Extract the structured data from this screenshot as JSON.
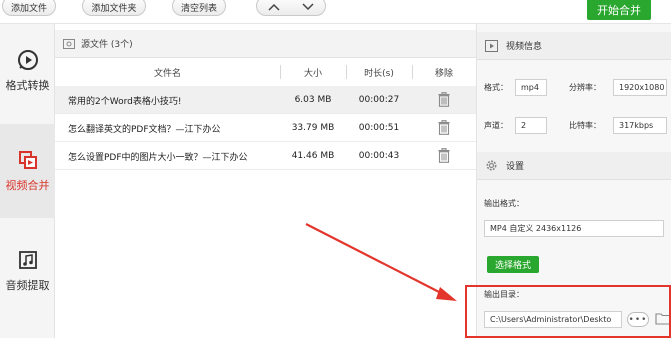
{
  "toolbar": {
    "add_file": "添加文件",
    "add_folder": "添加文件夹",
    "clear_list": "清空列表",
    "move_up": "∧",
    "move_down": "∨",
    "start_merge": "开始合并"
  },
  "sidebar": {
    "items": [
      {
        "label": "格式转换",
        "icon": "convert-play-icon"
      },
      {
        "label": "视频合并",
        "icon": "video-merge-icon",
        "active": true
      },
      {
        "label": "音频提取",
        "icon": "music-note-icon"
      }
    ]
  },
  "source": {
    "title": "源文件 (3个)",
    "columns": {
      "name": "文件名",
      "size": "大小",
      "duration": "时长(s)",
      "remove": "移除"
    },
    "rows": [
      {
        "name": "常用的2个Word表格小技巧!",
        "size": "6.03 MB",
        "duration": "00:00:27"
      },
      {
        "name": "怎么翻译英文的PDF文档？—江下办公",
        "size": "33.79 MB",
        "duration": "00:00:51"
      },
      {
        "name": "怎么设置PDF中的图片大小一致？—江下办公",
        "size": "41.46 MB",
        "duration": "00:00:43"
      }
    ]
  },
  "video_info": {
    "title": "视频信息",
    "format_label": "格式：",
    "format_value": "mp4",
    "resolution_label": "分辨率：",
    "resolution_value": "1920x1080",
    "channel_label": "声道：",
    "channel_value": "2",
    "bitrate_label": "比特率：",
    "bitrate_value": "317kbps"
  },
  "settings": {
    "title": "设置",
    "output_format_label": "输出格式：",
    "output_format_value": "MP4 自定义 2436x1126",
    "choose_format": "选择格式",
    "output_dir_label": "输出目录：",
    "output_dir_value": "C:\\Users\\Administrator\\Deskto",
    "browse_dots": "•••"
  },
  "colors": {
    "accent_green": "#2aa72e",
    "active_red": "#d9342b",
    "annotation_red": "#e3352b"
  }
}
